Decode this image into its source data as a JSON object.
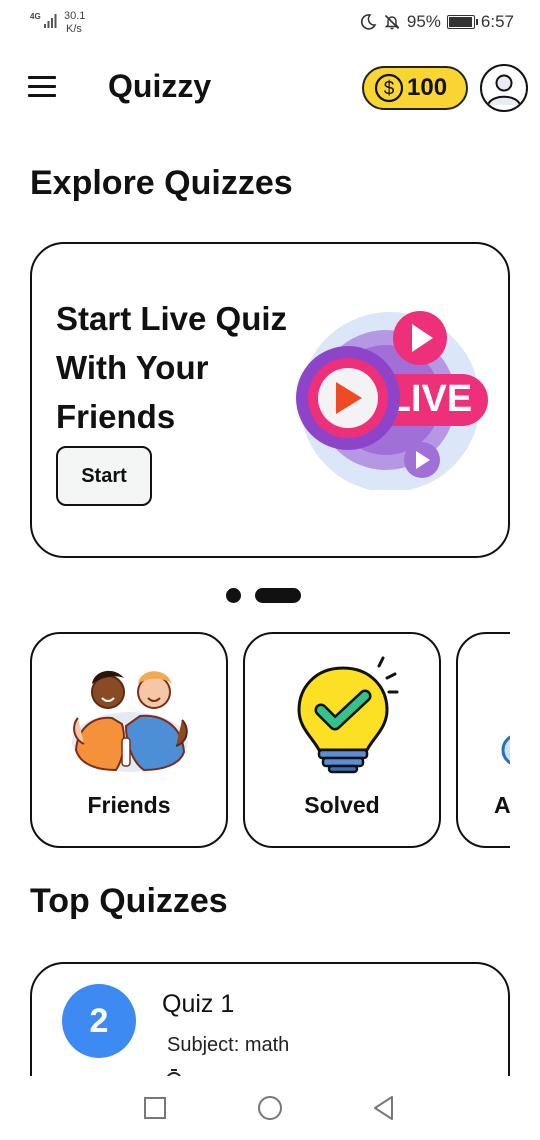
{
  "status_bar": {
    "network": "4G",
    "speed_value": "30.1",
    "speed_unit": "K/s",
    "battery": "95%",
    "battery_level": 0.95,
    "time": "6:57"
  },
  "header": {
    "title": "Quizzy",
    "coins": "100"
  },
  "explore": {
    "heading": "Explore Quizzes",
    "banner": {
      "title": "Start Live Quiz With Your Friends",
      "start_label": "Start",
      "badge_text": "LIVE"
    },
    "carousel": {
      "total": 2,
      "active": 1
    }
  },
  "categories": [
    {
      "label": "Friends",
      "icon": "friends-icon"
    },
    {
      "label": "Solved",
      "icon": "lightbulb-check-icon"
    },
    {
      "label": "Al",
      "icon": "clock-icon"
    }
  ],
  "top_quizzes": {
    "heading": "Top Quizzes",
    "items": [
      {
        "number": "2",
        "name": "Quiz 1",
        "subject": "Subject: math"
      }
    ]
  },
  "colors": {
    "coin_bg": "#f9d531",
    "quiz_number_bg": "#3d8bf2",
    "live_pink": "#ee2f7a",
    "live_purple": "#8e44c9"
  }
}
